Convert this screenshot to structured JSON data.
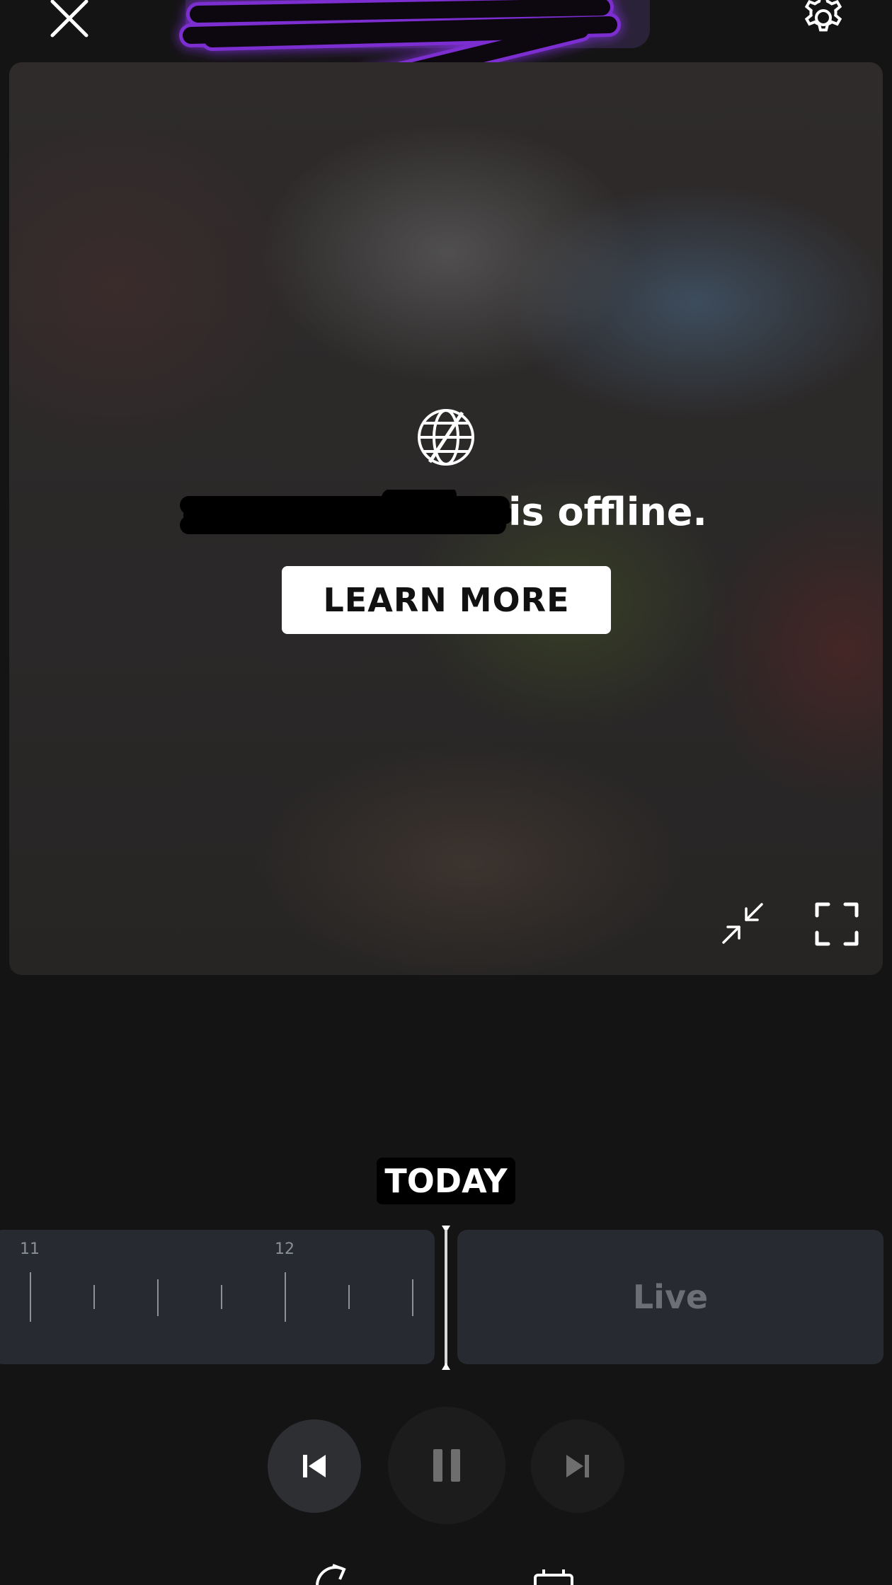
{
  "header": {
    "close_icon": "close-icon",
    "settings_icon": "gear-icon"
  },
  "video": {
    "status_icon": "globe-offline-icon",
    "offline_message": "is offline.",
    "learn_more_label": "LEARN MORE",
    "collapse_icon": "collapse-arrows-icon",
    "fullscreen_icon": "fullscreen-icon"
  },
  "timeline": {
    "date_label": "TODAY",
    "tick_labels": [
      "11",
      "12"
    ],
    "live_label": "Live"
  },
  "playback": {
    "previous_icon": "skip-previous-icon",
    "pause_icon": "pause-icon",
    "next_icon": "skip-next-icon"
  },
  "colors": {
    "background": "#141414",
    "accent_redaction": "#7b2fd1",
    "track": "#272a30"
  }
}
